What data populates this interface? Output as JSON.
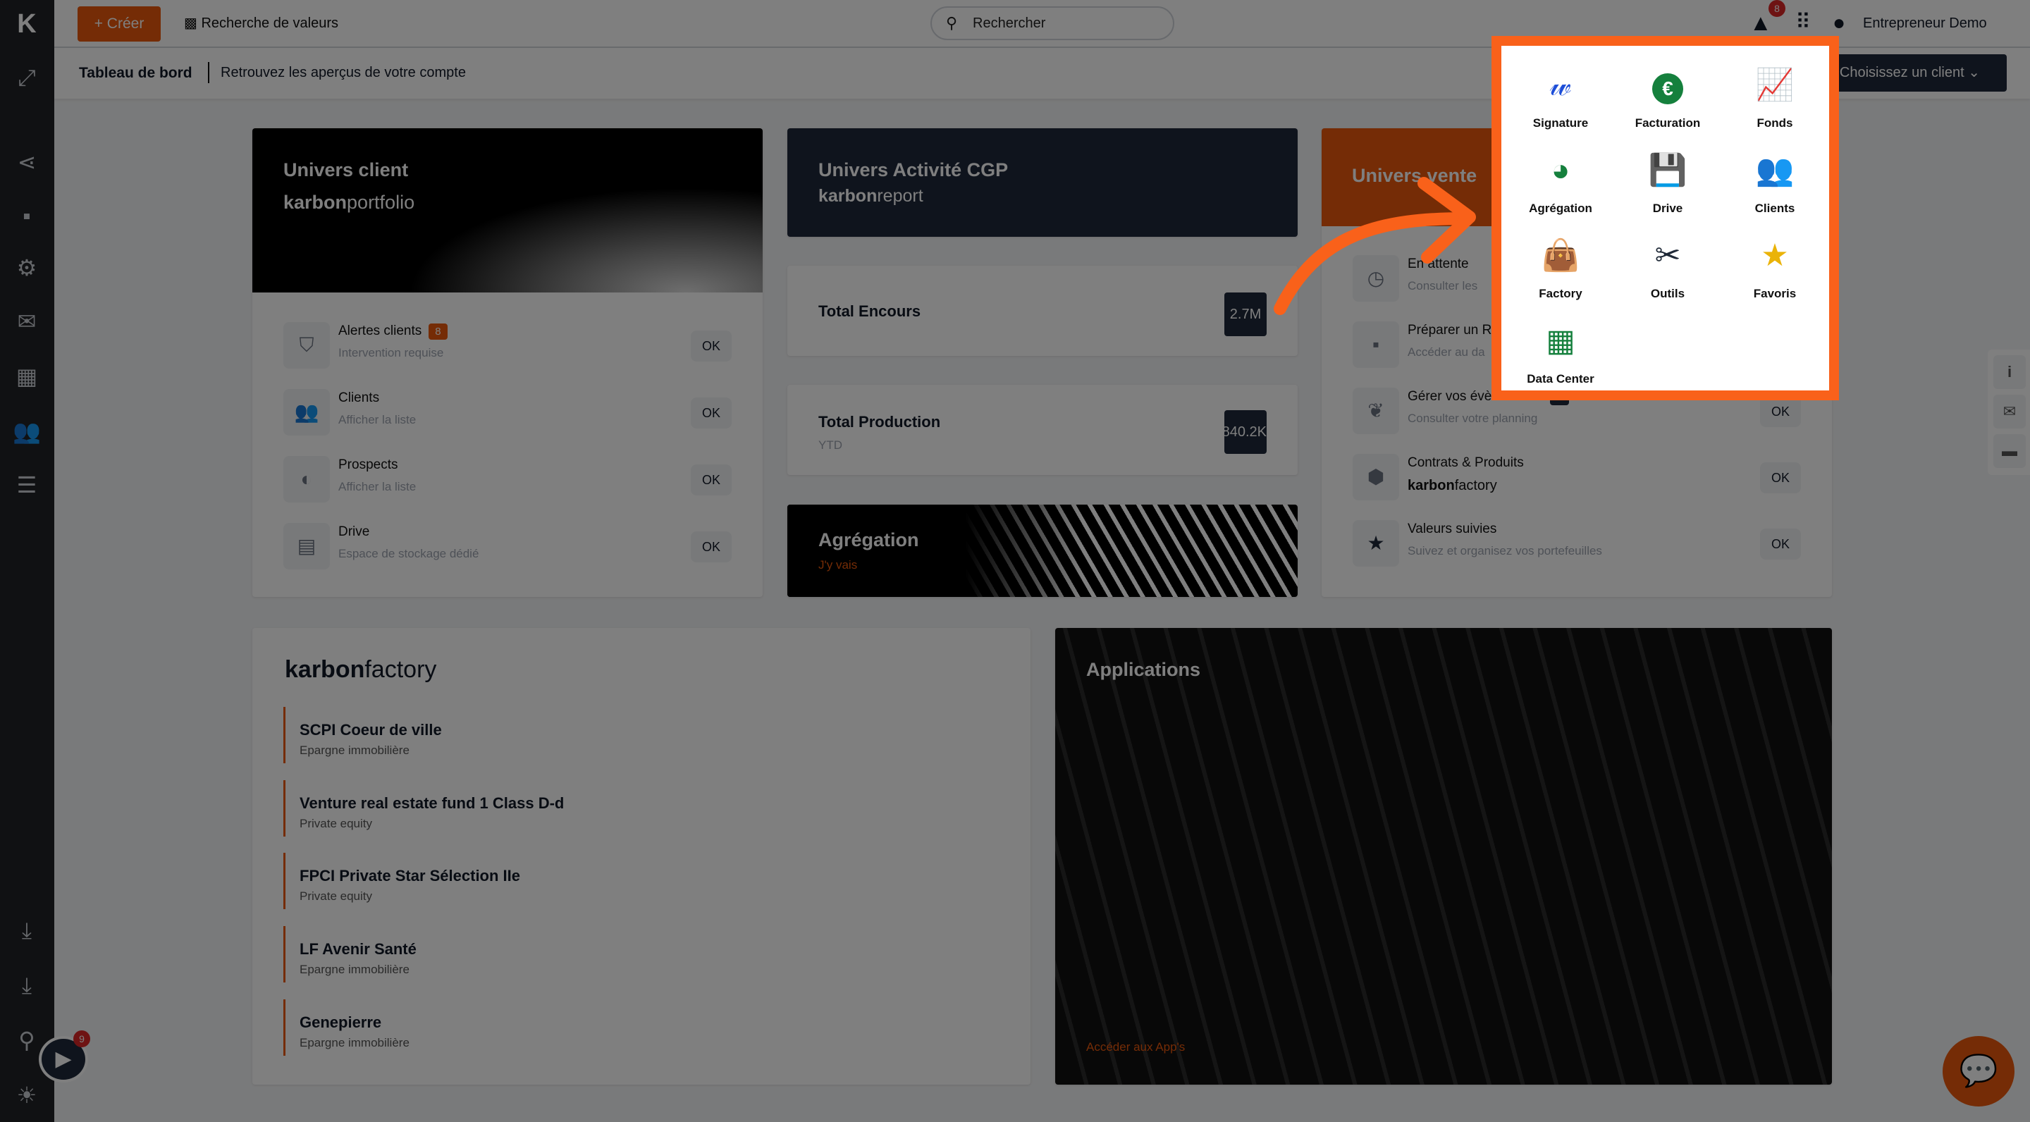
{
  "topbar": {
    "create_label": "Créer",
    "value_search_label": "Recherche de valeurs",
    "search_placeholder": "Rechercher",
    "alert_count": "8",
    "user_name": "Entrepreneur Demo"
  },
  "subbar": {
    "title": "Tableau de bord",
    "subtitle": "Retrouvez les aperçus de votre compte",
    "client_select": "Choisissez un client"
  },
  "client_universe": {
    "title": "Univers client",
    "logo_bold": "karbon",
    "logo_light": "portfolio",
    "rows": [
      {
        "title": "Alertes clients",
        "badge": "8",
        "sub": "Intervention requise",
        "action": "OK"
      },
      {
        "title": "Clients",
        "sub": "Afficher la liste",
        "action": "OK"
      },
      {
        "title": "Prospects",
        "sub": "Afficher la liste",
        "action": "OK"
      },
      {
        "title": "Drive",
        "sub": "Espace de stockage dédié",
        "action": "OK"
      }
    ]
  },
  "activity": {
    "title": "Univers Activité CGP",
    "logo_bold": "karbon",
    "logo_light": "report",
    "encours_label": "Total Encours",
    "encours_value": "2.7M",
    "production_label": "Total Production",
    "production_sub": "YTD",
    "production_value": "840.2K",
    "aggregation_title": "Agrégation",
    "aggregation_link": "J'y vais"
  },
  "sales": {
    "title": "Univers vente",
    "rows": [
      {
        "title": "En attente",
        "sub": "Consulter les"
      },
      {
        "title": "Préparer un R",
        "sub": "Accéder au da"
      },
      {
        "title": "Gérer vos évènements",
        "badge": "0",
        "sub": "Consulter votre planning",
        "action": "OK"
      },
      {
        "title": "Contrats & Produits",
        "logo_bold": "karbon",
        "logo_light": "factory",
        "action": "OK"
      },
      {
        "title": "Valeurs suivies",
        "sub": "Suivez et organisez vos portefeuilles",
        "action": "OK"
      }
    ]
  },
  "factory": {
    "logo_bold": "karbon",
    "logo_light": "factory",
    "items": [
      {
        "name": "SCPI Coeur de ville",
        "type": "Epargne immobilière"
      },
      {
        "name": "Venture real estate fund 1 Class D-d",
        "type": "Private equity"
      },
      {
        "name": "FPCI Private Star Sélection IIe",
        "type": "Private equity"
      },
      {
        "name": "LF Avenir Santé",
        "type": "Epargne immobilière"
      },
      {
        "name": "Genepierre",
        "type": "Epargne immobilière"
      }
    ]
  },
  "applications": {
    "title": "Applications",
    "link": "Accéder aux App's"
  },
  "apps_menu": [
    {
      "label": "Signature",
      "icon": "signature-icon",
      "color": "#1d4ed8"
    },
    {
      "label": "Facturation",
      "icon": "euro-icon",
      "color": "#15803d"
    },
    {
      "label": "Fonds",
      "icon": "presentation-chart-icon",
      "color": "#1f2937"
    },
    {
      "label": "Agrégation",
      "icon": "pie-chart-icon",
      "color": "#15803d"
    },
    {
      "label": "Drive",
      "icon": "floppy-disk-icon",
      "color": "#1f2937"
    },
    {
      "label": "Clients",
      "icon": "users-icon",
      "color": "#1d4ed8"
    },
    {
      "label": "Factory",
      "icon": "shopping-bag-icon",
      "color": "#4338ca"
    },
    {
      "label": "Outils",
      "icon": "tools-icon",
      "color": "#1f2937"
    },
    {
      "label": "Favoris",
      "icon": "star-icon",
      "color": "#eab308"
    },
    {
      "label": "Data Center",
      "icon": "table-icon",
      "color": "#15803d"
    }
  ],
  "video_badge": "9",
  "colors": {
    "accent": "#ea580c",
    "highlight": "#f9611a",
    "dark": "#1e293b"
  }
}
